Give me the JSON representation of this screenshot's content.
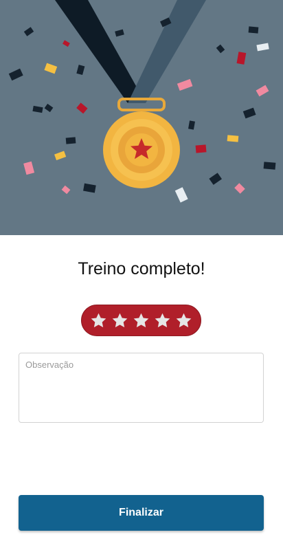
{
  "hero": {
    "illustration": "medal-with-confetti",
    "background_color": "#637785",
    "medal_color": "#f2b541",
    "star_color": "#c62a2a"
  },
  "title": "Treino completo!",
  "rating": {
    "value": 0,
    "max": 5,
    "background_color": "#b01f2a",
    "star_color": "#e6e6e6"
  },
  "note": {
    "placeholder": "Observação",
    "value": ""
  },
  "finish_button": {
    "label": "Finalizar",
    "color": "#12628f"
  }
}
